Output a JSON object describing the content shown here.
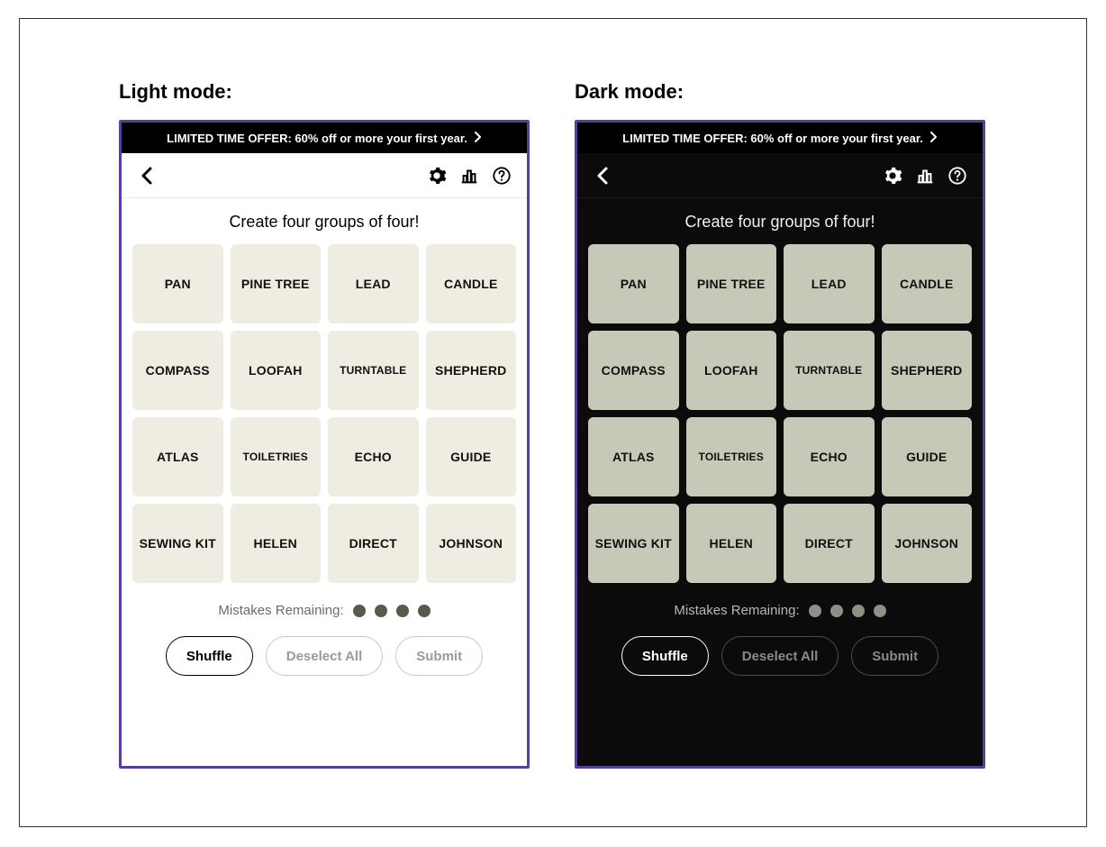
{
  "labels": {
    "light_mode": "Light mode:",
    "dark_mode": "Dark mode:"
  },
  "promo": {
    "text": "LIMITED TIME OFFER: 60% off or more your first year."
  },
  "game": {
    "instructions": "Create four groups of four!",
    "tiles": [
      "PAN",
      "PINE TREE",
      "LEAD",
      "CANDLE",
      "COMPASS",
      "LOOFAH",
      "TURNTABLE",
      "SHEPHERD",
      "ATLAS",
      "TOILETRIES",
      "ECHO",
      "GUIDE",
      "SEWING KIT",
      "HELEN",
      "DIRECT",
      "JOHNSON"
    ],
    "small_tiles": [
      "TURNTABLE",
      "TOILETRIES"
    ],
    "mistakes_label": "Mistakes Remaining:",
    "mistakes_remaining": 4,
    "buttons": {
      "shuffle": "Shuffle",
      "deselect": "Deselect All",
      "submit": "Submit"
    }
  }
}
